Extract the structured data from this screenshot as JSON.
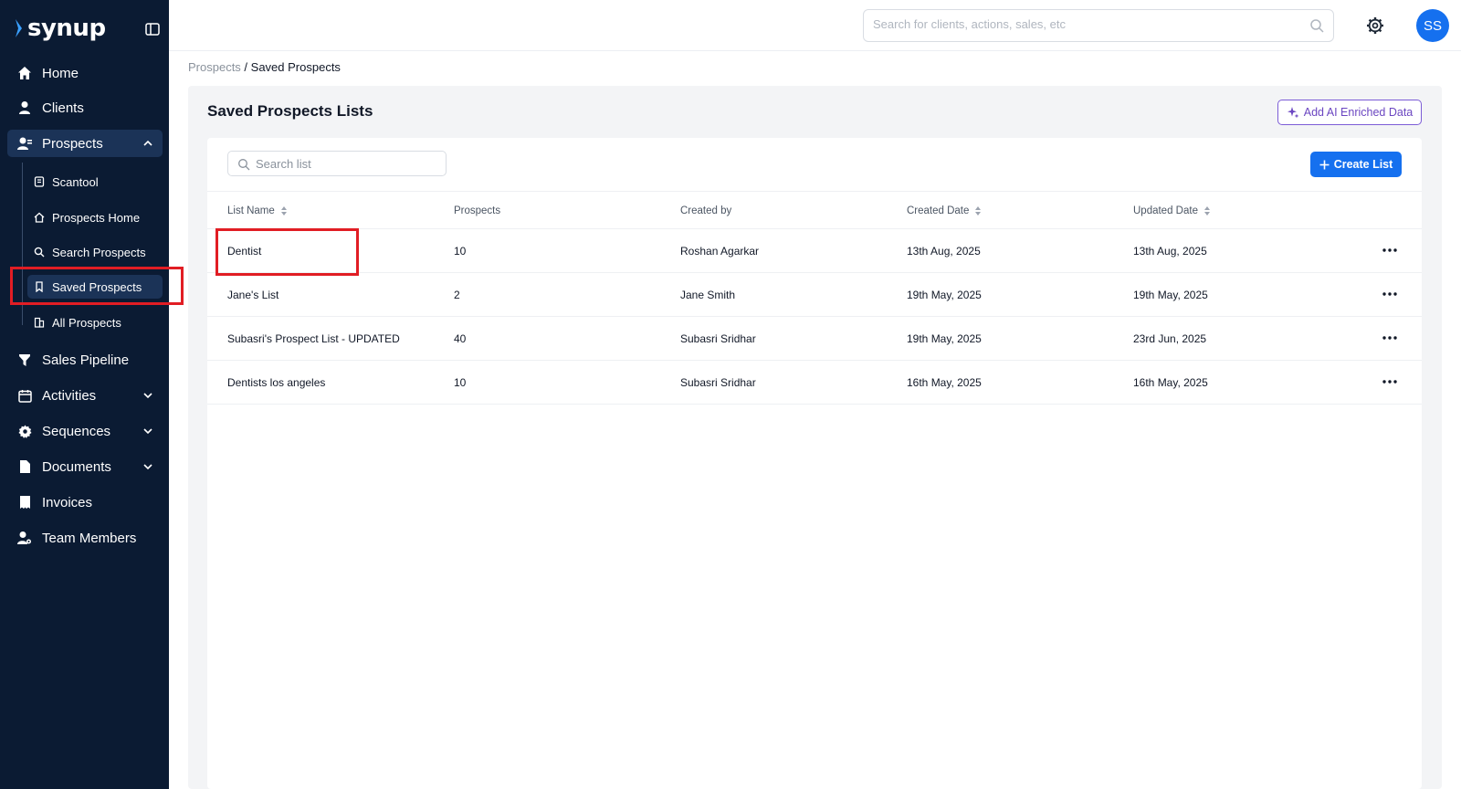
{
  "brand": {
    "name": "synup"
  },
  "sidebar": {
    "items": [
      {
        "label": "Home",
        "icon": "home-icon"
      },
      {
        "label": "Clients",
        "icon": "user-icon"
      },
      {
        "label": "Prospects",
        "icon": "prospects-icon",
        "expanded": true
      },
      {
        "label": "Sales Pipeline",
        "icon": "funnel-icon"
      },
      {
        "label": "Activities",
        "icon": "calendar-icon"
      },
      {
        "label": "Sequences",
        "icon": "gear-icon"
      },
      {
        "label": "Documents",
        "icon": "document-icon"
      },
      {
        "label": "Invoices",
        "icon": "invoice-icon"
      },
      {
        "label": "Team Members",
        "icon": "team-icon"
      }
    ],
    "prospects_sub": [
      {
        "label": "Scantool",
        "icon": "scan-icon"
      },
      {
        "label": "Prospects Home",
        "icon": "home-icon"
      },
      {
        "label": "Search Prospects",
        "icon": "search-icon"
      },
      {
        "label": "Saved Prospects",
        "icon": "bookmark-icon",
        "active": true
      },
      {
        "label": "All Prospects",
        "icon": "building-icon"
      }
    ]
  },
  "topbar": {
    "search_placeholder": "Search for clients, actions, sales, etc",
    "avatar_initials": "SS"
  },
  "breadcrumb": {
    "parent": "Prospects",
    "separator": " / ",
    "current": "Saved Prospects"
  },
  "main": {
    "title": "Saved Prospects Lists",
    "ai_button": "Add AI Enriched Data",
    "list_search_placeholder": "Search list",
    "create_button": "Create List"
  },
  "table": {
    "columns": [
      "List Name",
      "Prospects",
      "Created by",
      "Created Date",
      "Updated Date"
    ],
    "rows": [
      {
        "name": "Dentist",
        "prospects": "10",
        "created_by": "Roshan Agarkar",
        "created": "13th Aug, 2025",
        "updated": "13th Aug, 2025"
      },
      {
        "name": "Jane's List",
        "prospects": "2",
        "created_by": "Jane Smith",
        "created": "19th May, 2025",
        "updated": "19th May, 2025"
      },
      {
        "name": "Subasri's Prospect List - UPDATED",
        "prospects": "40",
        "created_by": "Subasri Sridhar",
        "created": "19th May, 2025",
        "updated": "23rd Jun, 2025"
      },
      {
        "name": "Dentists los angeles",
        "prospects": "10",
        "created_by": "Subasri Sridhar",
        "created": "16th May, 2025",
        "updated": "16th May, 2025"
      }
    ]
  },
  "colors": {
    "sidebar_bg": "#0b1b33",
    "accent": "#1570ef",
    "highlight": "#e11d24",
    "ai_purple": "#6b46c1"
  }
}
